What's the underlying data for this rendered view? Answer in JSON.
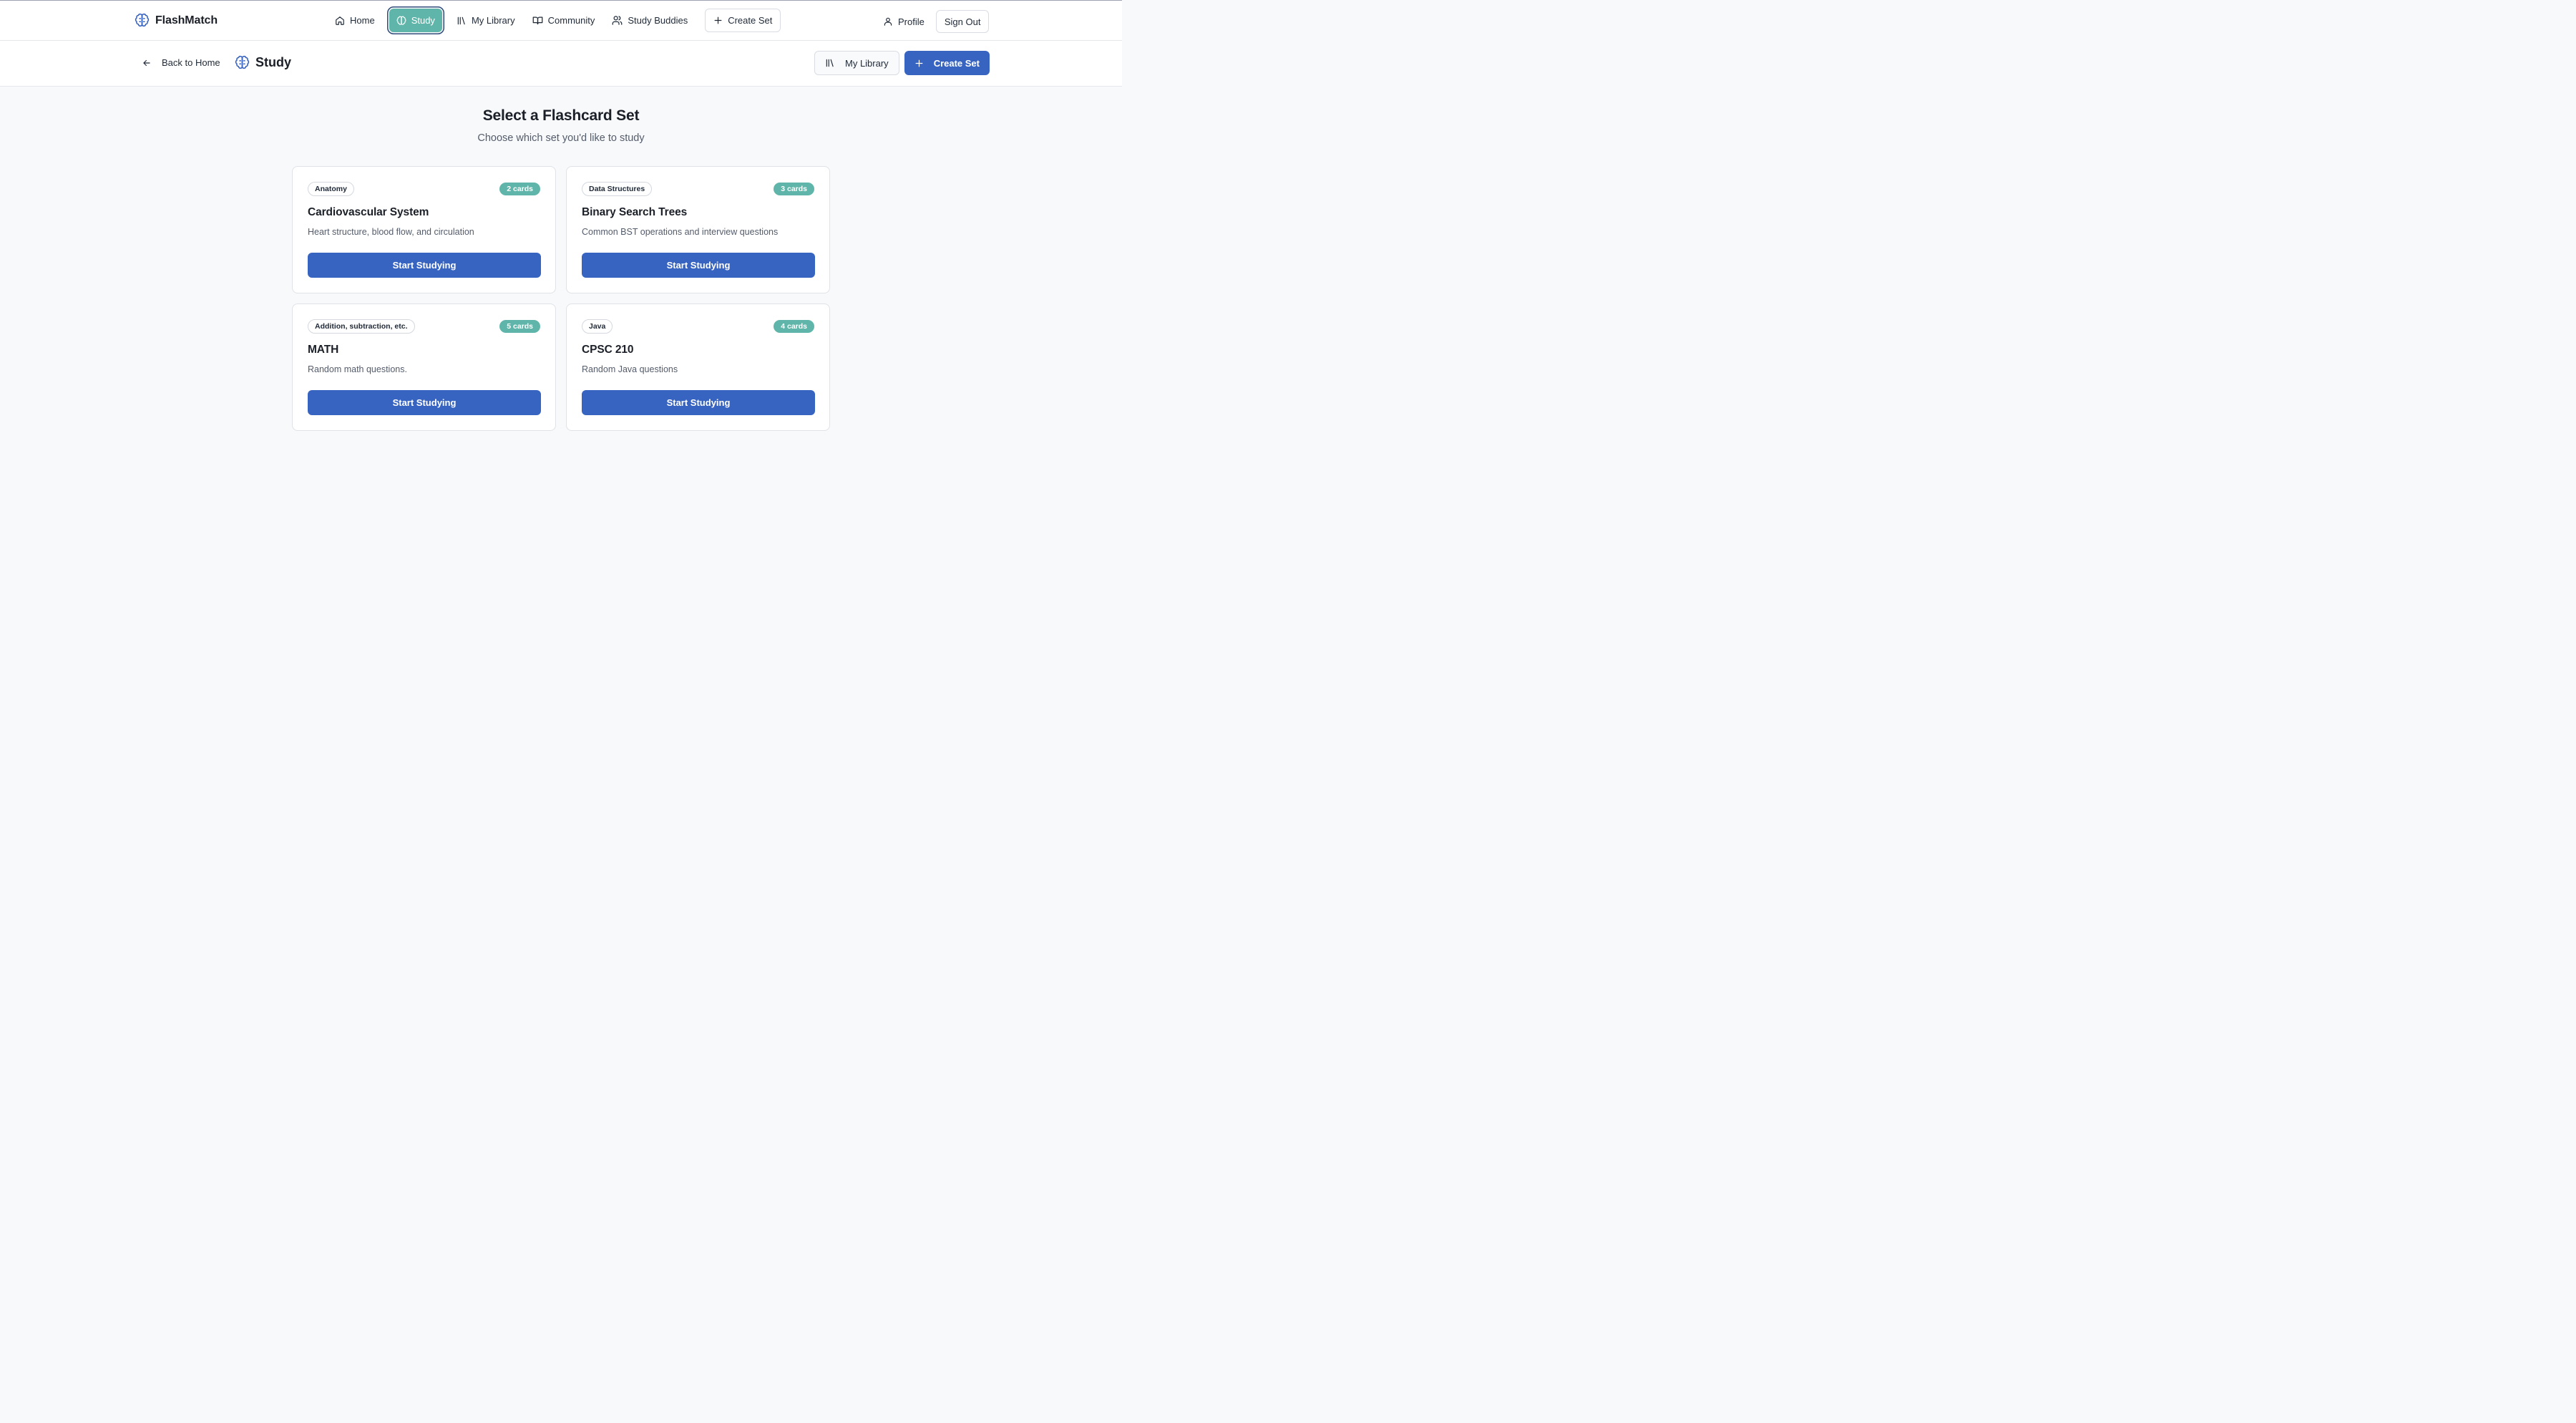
{
  "app": {
    "name": "FlashMatch"
  },
  "nav": {
    "home": "Home",
    "study": "Study",
    "library": "My Library",
    "community": "Community",
    "buddies": "Study Buddies",
    "create": "Create Set",
    "profile": "Profile",
    "signout": "Sign Out"
  },
  "subheader": {
    "back": "Back to Home",
    "title": "Study",
    "library": "My Library",
    "create": "Create Set"
  },
  "main": {
    "title": "Select a Flashcard Set",
    "subtitle": "Choose which set you'd like to study"
  },
  "sets": [
    {
      "tag": "Anatomy",
      "count": "2 cards",
      "title": "Cardiovascular System",
      "description": "Heart structure, blood flow, and circulation",
      "button": "Start Studying"
    },
    {
      "tag": "Data Structures",
      "count": "3 cards",
      "title": "Binary Search Trees",
      "description": "Common BST operations and interview questions",
      "button": "Start Studying"
    },
    {
      "tag": "Addition, subtraction, etc.",
      "count": "5 cards",
      "title": "MATH",
      "description": "Random math questions.",
      "button": "Start Studying"
    },
    {
      "tag": "Java",
      "count": "4 cards",
      "title": "CPSC 210",
      "description": "Random Java questions",
      "button": "Start Studying"
    }
  ],
  "colors": {
    "accent": "#3764c1",
    "teal": "#5fb5a9",
    "background": "#f8f9fb"
  },
  "icons": [
    "brain-icon",
    "home-icon",
    "library-icon",
    "book-icon",
    "users-icon",
    "plus-icon",
    "user-icon",
    "arrow-left-icon"
  ]
}
